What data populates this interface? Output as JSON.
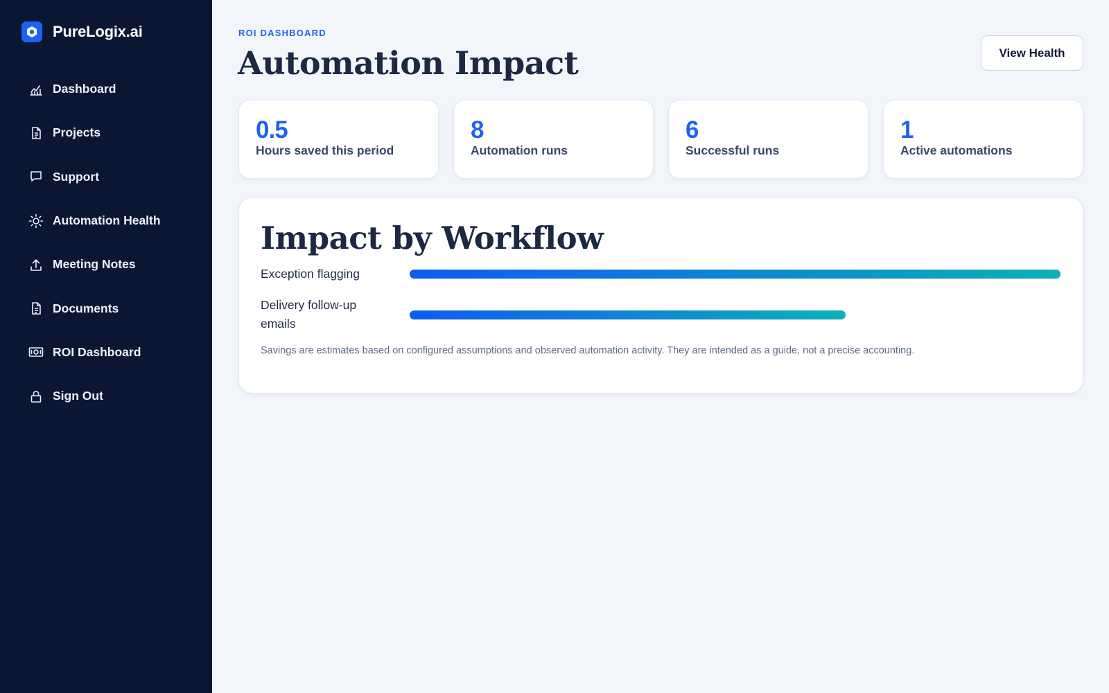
{
  "app": {
    "brand_name": "PureLogix.ai",
    "accent_color": "#1e63f0",
    "sidebar_color": "#0b1633"
  },
  "sidebar": {
    "items": [
      {
        "label": "Dashboard",
        "icon": "chart-icon"
      },
      {
        "label": "Projects",
        "icon": "document-icon"
      },
      {
        "label": "Support",
        "icon": "chat-bubble-icon"
      },
      {
        "label": "Automation Health",
        "icon": "sun-icon"
      },
      {
        "label": "Meeting Notes",
        "icon": "upload-icon"
      },
      {
        "label": "Documents",
        "icon": "document-icon"
      },
      {
        "label": "ROI Dashboard",
        "icon": "money-icon"
      },
      {
        "label": "Sign Out",
        "icon": "lock-icon"
      }
    ]
  },
  "header": {
    "eyebrow": "ROI DASHBOARD",
    "title": "Automation Impact",
    "view_health_label": "View Health"
  },
  "stats": [
    {
      "value": "0.5",
      "label": "Hours saved this period"
    },
    {
      "value": "8",
      "label": "Automation runs"
    },
    {
      "value": "6",
      "label": "Successful runs"
    },
    {
      "value": "1",
      "label": "Active automations"
    }
  ],
  "impact": {
    "title": "Impact by Workflow",
    "workflows": [
      {
        "label": "Exception flagging",
        "fraction": 1.0
      },
      {
        "label": "Delivery follow-up emails",
        "fraction": 0.67
      }
    ],
    "note": "Savings are estimates based on configured assumptions and observed automation activity. They are intended as a guide, not a precise accounting.",
    "bar_gradient": [
      "#0f5bf0",
      "#0bb0b8"
    ]
  }
}
